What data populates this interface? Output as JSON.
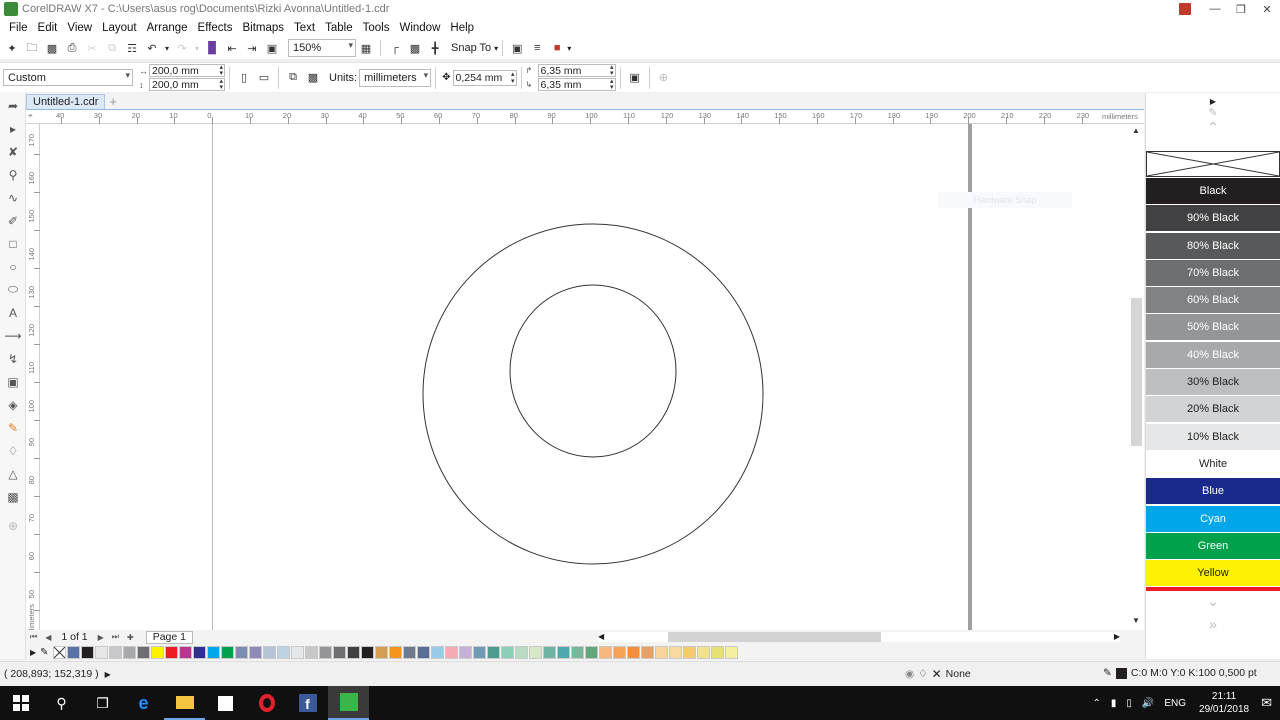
{
  "window": {
    "title": "CorelDRAW X7 - C:\\Users\\asus rog\\Documents\\Rizki Avonna\\Untitled-1.cdr",
    "buttons": [
      "minimize",
      "maximize",
      "close"
    ]
  },
  "menu": [
    "File",
    "Edit",
    "View",
    "Layout",
    "Arrange",
    "Effects",
    "Bitmaps",
    "Text",
    "Table",
    "Tools",
    "Window",
    "Help"
  ],
  "toolbar1": {
    "zoom": "150%",
    "snap_label": "Snap To"
  },
  "toolbar2": {
    "page_preset": "Custom",
    "width": "200,0 mm",
    "height": "200,0 mm",
    "units_label": "Units:",
    "units_value": "millimeters",
    "nudge": "0,254 mm",
    "dup_x": "6,35 mm",
    "dup_y": "6,35 mm"
  },
  "document": {
    "tab": "Untitled-1.cdr"
  },
  "rulers": {
    "unit": "millimeters",
    "h_labels": [
      "40",
      "30",
      "20",
      "10",
      "0",
      "10",
      "20",
      "30",
      "40",
      "50",
      "60",
      "70",
      "80",
      "90",
      "100",
      "110",
      "120",
      "130",
      "140",
      "150",
      "160",
      "170",
      "180",
      "190",
      "200",
      "210",
      "220",
      "230"
    ],
    "v_labels": [
      "170",
      "160",
      "150",
      "140",
      "130",
      "120",
      "110",
      "100",
      "90",
      "80",
      "70",
      "60",
      "50"
    ]
  },
  "canvas": {
    "snap_hint": "Hardware Snap"
  },
  "page_nav": {
    "count": "1 of 1",
    "page_tab": "Page 1"
  },
  "palette": {
    "items": [
      {
        "name": "Black",
        "color": "#231f20",
        "text_color": "#ffffff"
      },
      {
        "name": "90% Black",
        "color": "#414042",
        "text_color": "#ffffff"
      },
      {
        "name": "80% Black",
        "color": "#58595b",
        "text_color": "#ffffff"
      },
      {
        "name": "70% Black",
        "color": "#6d6e71",
        "text_color": "#ffffff"
      },
      {
        "name": "60% Black",
        "color": "#808285",
        "text_color": "#ffffff"
      },
      {
        "name": "50% Black",
        "color": "#939598",
        "text_color": "#ffffff"
      },
      {
        "name": "40% Black",
        "color": "#a7a9ac",
        "text_color": "#ffffff"
      },
      {
        "name": "30% Black",
        "color": "#bcbec0",
        "text_color": "#222222"
      },
      {
        "name": "20% Black",
        "color": "#d1d3d4",
        "text_color": "#222222"
      },
      {
        "name": "10% Black",
        "color": "#e6e7e8",
        "text_color": "#222222"
      },
      {
        "name": "White",
        "color": "#ffffff",
        "text_color": "#222222"
      },
      {
        "name": "Blue",
        "color": "#1a2a8c",
        "text_color": "#ffffff"
      },
      {
        "name": "Cyan",
        "color": "#00a6ea",
        "text_color": "#ffffff"
      },
      {
        "name": "Green",
        "color": "#00a14b",
        "text_color": "#ffffff"
      },
      {
        "name": "Yellow",
        "color": "#fff200",
        "text_color": "#222222"
      }
    ]
  },
  "bottom_swatches": [
    "#5b6fa8",
    "#231f20",
    "#e6e7e8",
    "#c7c8ca",
    "#a7a9ac",
    "#6d6e71",
    "#fff200",
    "#ed1c24",
    "#b5378f",
    "#2e3192",
    "#00a6ea",
    "#00a14b",
    "#7a8fb3",
    "#8e8bb8",
    "#b5c4d8",
    "#bcd3e6",
    "#e6e7e8",
    "#c7c8ca",
    "#939598",
    "#6d6e71",
    "#414042",
    "#231f20",
    "#d49d4f",
    "#f7941d",
    "#6f7a8c",
    "#5a6d96",
    "#9bc9ea",
    "#f6aab4",
    "#c7b0d6",
    "#6e9bb5",
    "#4d9b8f",
    "#8ccfb8",
    "#b8dcc2",
    "#d5e9c7",
    "#6cb4a4",
    "#4fa8b0",
    "#78b89a",
    "#62a67c",
    "#f6b77d",
    "#f6a358",
    "#f58e3c",
    "#eaa060",
    "#fbd49c",
    "#fbd8a0",
    "#f7c970",
    "#f2e28c",
    "#e8e074",
    "#f5f0a0"
  ],
  "status": {
    "cursor": "( 208,893; 152,319 )",
    "fill": "None",
    "outline": "C:0 M:0 Y:0 K:100  0,500 pt"
  },
  "taskbar": {
    "lang": "ENG",
    "time": "21:11",
    "date": "29/01/2018"
  }
}
